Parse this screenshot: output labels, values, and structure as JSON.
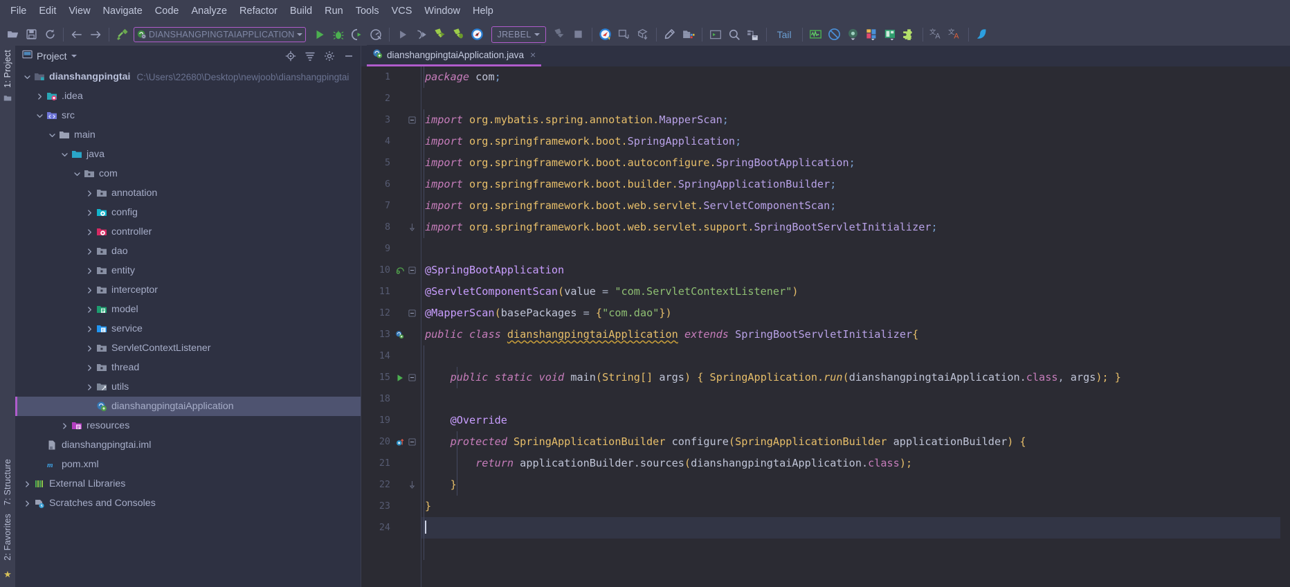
{
  "window": {
    "theme_bg": "#2e3142",
    "editor_bg": "#2b2b33",
    "accent": "#b05ccc"
  },
  "menubar": {
    "items": [
      {
        "label": "File"
      },
      {
        "label": "Edit"
      },
      {
        "label": "View"
      },
      {
        "label": "Navigate"
      },
      {
        "label": "Code"
      },
      {
        "label": "Analyze"
      },
      {
        "label": "Refactor"
      },
      {
        "label": "Build"
      },
      {
        "label": "Run"
      },
      {
        "label": "Tools"
      },
      {
        "label": "VCS"
      },
      {
        "label": "Window"
      },
      {
        "label": "Help"
      }
    ]
  },
  "toolbar": {
    "open_tip": "Open",
    "save_tip": "Save All",
    "sync_tip": "Synchronize",
    "back_tip": "Back",
    "forward_tip": "Forward",
    "build_tip": "Build Project",
    "run_config_label": "DIANSHANGPINGTAIAPPLICATION",
    "run_tip": "Run",
    "debug_tip": "Debug",
    "run_coverage_tip": "Run with Coverage",
    "profile_tip": "Profile",
    "rerun_tip": "Rerun",
    "attach_tip": "Attach",
    "jrebel_run_tip": "Run with JRebel",
    "jrebel_debug_tip": "Debug with JRebel",
    "jrebel_console_tip": "JRebel Console",
    "jrebel_label": "JREBEL",
    "stop_grey_tip": "Stop",
    "stop_tip": "Stop",
    "update_tip": "Update Project",
    "commit_tip": "Commit",
    "push_tip": "Push",
    "settings_tip": "Settings",
    "project_structure_tip": "Project Structure",
    "terminal_tip": "Terminal",
    "search_tip": "Search Everywhere",
    "database_tip": "Database",
    "tail_label": "Tail",
    "monitor_tip": "Monitor",
    "noaccess_tip": "No Access",
    "record_tip": "Record",
    "layout_tip": "Layout",
    "preview_tip": "Preview",
    "plugin_tip": "Plugin",
    "translate_tip": "Translate",
    "translate2_tip": "Translate Reverse",
    "cloud_tip": "Cloud"
  },
  "leftstrip": {
    "project_label": "1: Project",
    "structure_label": "7: Structure",
    "favorites_label": "2: Favorites"
  },
  "project_panel": {
    "title": "Project",
    "title_caret": "▾",
    "icons": [
      {
        "name": "locate-icon"
      },
      {
        "name": "collapse-all-icon"
      },
      {
        "name": "settings-icon"
      },
      {
        "name": "hide-icon"
      }
    ],
    "tree": [
      {
        "depth": 0,
        "arrow": "down",
        "icon": "module-folder",
        "label": "dianshangpingtai",
        "bold": true,
        "path": "C:\\Users\\22680\\Desktop\\newjoob\\dianshangpingtai"
      },
      {
        "depth": 1,
        "arrow": "right",
        "icon": "idea-folder",
        "label": ".idea"
      },
      {
        "depth": 1,
        "arrow": "down",
        "icon": "src-folder",
        "label": "src"
      },
      {
        "depth": 2,
        "arrow": "down",
        "icon": "plain-folder",
        "label": "main"
      },
      {
        "depth": 3,
        "arrow": "down",
        "icon": "java-folder",
        "label": "java"
      },
      {
        "depth": 4,
        "arrow": "down",
        "icon": "pkg-folder",
        "label": "com"
      },
      {
        "depth": 5,
        "arrow": "right",
        "icon": "pkg-folder",
        "label": "annotation"
      },
      {
        "depth": 5,
        "arrow": "right",
        "icon": "config-folder",
        "label": "config"
      },
      {
        "depth": 5,
        "arrow": "right",
        "icon": "controller-folder",
        "label": "controller"
      },
      {
        "depth": 5,
        "arrow": "right",
        "icon": "pkg-folder",
        "label": "dao"
      },
      {
        "depth": 5,
        "arrow": "right",
        "icon": "pkg-folder",
        "label": "entity"
      },
      {
        "depth": 5,
        "arrow": "right",
        "icon": "pkg-folder",
        "label": "interceptor"
      },
      {
        "depth": 5,
        "arrow": "right",
        "icon": "model-folder",
        "label": "model"
      },
      {
        "depth": 5,
        "arrow": "right",
        "icon": "service-folder",
        "label": "service"
      },
      {
        "depth": 5,
        "arrow": "right",
        "icon": "pkg-folder",
        "label": "ServletContextListener"
      },
      {
        "depth": 5,
        "arrow": "right",
        "icon": "pkg-folder",
        "label": "thread"
      },
      {
        "depth": 5,
        "arrow": "right",
        "icon": "utils-folder",
        "label": "utils"
      },
      {
        "depth": 5,
        "arrow": "none",
        "icon": "spring-class",
        "label": "dianshangpingtaiApplication",
        "selected": true
      },
      {
        "depth": 3,
        "arrow": "right",
        "icon": "resources-folder",
        "label": "resources"
      },
      {
        "depth": 1,
        "arrow": "none",
        "icon": "iml-file",
        "label": "dianshangpingtai.iml"
      },
      {
        "depth": 1,
        "arrow": "none",
        "icon": "maven-file",
        "label": "pom.xml"
      },
      {
        "depth": 0,
        "arrow": "right",
        "icon": "libraries",
        "label": "External Libraries"
      },
      {
        "depth": 0,
        "arrow": "right",
        "icon": "scratches",
        "label": "Scratches and Consoles"
      }
    ]
  },
  "editor": {
    "tab": {
      "label": "dianshangpingtaiApplication.java",
      "close": "×",
      "icon": "spring-class-icon"
    },
    "lines": [
      {
        "num": "1",
        "gutter": "",
        "fold": "none",
        "indent": 0,
        "tokens": [
          {
            "t": "package ",
            "c": "kwp"
          },
          {
            "t": "com",
            "c": "id"
          },
          {
            "t": ";",
            "c": "semi"
          }
        ]
      },
      {
        "num": "2",
        "gutter": "",
        "fold": "none",
        "indent": 0,
        "tokens": []
      },
      {
        "num": "3",
        "gutter": "",
        "fold": "start",
        "indent": 0,
        "tokens": [
          {
            "t": "import ",
            "c": "kwp"
          },
          {
            "t": "org.mybatis.spring.annotation.",
            "c": "pkg"
          },
          {
            "t": "MapperScan",
            "c": "cls"
          },
          {
            "t": ";",
            "c": "semi"
          }
        ]
      },
      {
        "num": "4",
        "gutter": "",
        "fold": "none",
        "indent": 0,
        "tokens": [
          {
            "t": "import ",
            "c": "kwp"
          },
          {
            "t": "org.springframework.boot.",
            "c": "pkg"
          },
          {
            "t": "SpringApplication",
            "c": "cls"
          },
          {
            "t": ";",
            "c": "semi"
          }
        ]
      },
      {
        "num": "5",
        "gutter": "",
        "fold": "none",
        "indent": 0,
        "tokens": [
          {
            "t": "import ",
            "c": "kwp"
          },
          {
            "t": "org.springframework.boot.autoconfigure.",
            "c": "pkg"
          },
          {
            "t": "SpringBootApplication",
            "c": "cls"
          },
          {
            "t": ";",
            "c": "semi"
          }
        ]
      },
      {
        "num": "6",
        "gutter": "",
        "fold": "none",
        "indent": 0,
        "tokens": [
          {
            "t": "import ",
            "c": "kwp"
          },
          {
            "t": "org.springframework.boot.builder.",
            "c": "pkg"
          },
          {
            "t": "SpringApplicationBuilder",
            "c": "cls"
          },
          {
            "t": ";",
            "c": "semi"
          }
        ]
      },
      {
        "num": "7",
        "gutter": "",
        "fold": "none",
        "indent": 0,
        "tokens": [
          {
            "t": "import ",
            "c": "kwp"
          },
          {
            "t": "org.springframework.boot.web.servlet.",
            "c": "pkg"
          },
          {
            "t": "ServletComponentScan",
            "c": "cls"
          },
          {
            "t": ";",
            "c": "semi"
          }
        ]
      },
      {
        "num": "8",
        "gutter": "",
        "fold": "end",
        "indent": 0,
        "tokens": [
          {
            "t": "import ",
            "c": "kwp"
          },
          {
            "t": "org.springframework.boot.web.servlet.support.",
            "c": "pkg"
          },
          {
            "t": "SpringBootServletInitializer",
            "c": "cls"
          },
          {
            "t": ";",
            "c": "semi"
          }
        ]
      },
      {
        "num": "9",
        "gutter": "",
        "fold": "none",
        "indent": 0,
        "tokens": []
      },
      {
        "num": "10",
        "gutter": "bean",
        "fold": "start",
        "indent": 0,
        "tokens": [
          {
            "t": "@SpringBootApplication",
            "c": "ann"
          }
        ]
      },
      {
        "num": "11",
        "gutter": "",
        "fold": "none",
        "indent": 0,
        "tokens": [
          {
            "t": "@ServletComponentScan",
            "c": "ann"
          },
          {
            "t": "(",
            "c": "paren"
          },
          {
            "t": "value",
            "c": "id"
          },
          {
            "t": " = ",
            "c": "punc"
          },
          {
            "t": "\"com.ServletContextListener\"",
            "c": "str"
          },
          {
            "t": ")",
            "c": "paren"
          }
        ]
      },
      {
        "num": "12",
        "gutter": "",
        "fold": "mid",
        "indent": 0,
        "tokens": [
          {
            "t": "@MapperScan",
            "c": "ann"
          },
          {
            "t": "(",
            "c": "paren"
          },
          {
            "t": "basePackages",
            "c": "id"
          },
          {
            "t": " = ",
            "c": "punc"
          },
          {
            "t": "{",
            "c": "brace"
          },
          {
            "t": "\"com.dao\"",
            "c": "str"
          },
          {
            "t": "}",
            "c": "brace"
          },
          {
            "t": ")",
            "c": "paren"
          }
        ]
      },
      {
        "num": "13",
        "gutter": "bean-run",
        "fold": "none",
        "indent": 0,
        "tokens": [
          {
            "t": "public ",
            "c": "kwp"
          },
          {
            "t": "class ",
            "c": "kwp"
          },
          {
            "t": "dianshangpingtaiApplication",
            "c": "ident-u wavy"
          },
          {
            "t": " ",
            "c": "punc"
          },
          {
            "t": "extends ",
            "c": "kwp"
          },
          {
            "t": "SpringBootServletInitializer",
            "c": "cls"
          },
          {
            "t": "{",
            "c": "brace"
          }
        ]
      },
      {
        "num": "14",
        "gutter": "",
        "fold": "none",
        "indent": 0,
        "tokens": []
      },
      {
        "num": "15",
        "gutter": "run",
        "fold": "start",
        "indent": 1,
        "tokens": [
          {
            "t": "    ",
            "c": "punc"
          },
          {
            "t": "public ",
            "c": "kwp"
          },
          {
            "t": "static ",
            "c": "kwp"
          },
          {
            "t": "void ",
            "c": "kwp"
          },
          {
            "t": "main",
            "c": "id"
          },
          {
            "t": "(",
            "c": "paren"
          },
          {
            "t": "String",
            "c": "typ"
          },
          {
            "t": "[] ",
            "c": "paren"
          },
          {
            "t": "args",
            "c": "id"
          },
          {
            "t": ") ",
            "c": "paren"
          },
          {
            "t": "{ ",
            "c": "brace"
          },
          {
            "t": "SpringApplication.",
            "c": "typ"
          },
          {
            "t": "run",
            "c": "fn"
          },
          {
            "t": "(",
            "c": "paren"
          },
          {
            "t": "dianshangpingtaiApplication.",
            "c": "id"
          },
          {
            "t": "class",
            "c": "kwpn"
          },
          {
            "t": ", ",
            "c": "punc"
          },
          {
            "t": "args",
            "c": "id"
          },
          {
            "t": "); ",
            "c": "paren"
          },
          {
            "t": "}",
            "c": "brace"
          }
        ]
      },
      {
        "num": "18",
        "gutter": "",
        "fold": "none",
        "indent": 1,
        "tokens": []
      },
      {
        "num": "19",
        "gutter": "",
        "fold": "none",
        "indent": 1,
        "tokens": [
          {
            "t": "    ",
            "c": "punc"
          },
          {
            "t": "@Override",
            "c": "ann"
          }
        ]
      },
      {
        "num": "20",
        "gutter": "override",
        "fold": "start",
        "indent": 1,
        "tokens": [
          {
            "t": "    ",
            "c": "punc"
          },
          {
            "t": "protected ",
            "c": "kwp"
          },
          {
            "t": "SpringApplicationBuilder ",
            "c": "typ"
          },
          {
            "t": "configure",
            "c": "id"
          },
          {
            "t": "(",
            "c": "paren"
          },
          {
            "t": "SpringApplicationBuilder ",
            "c": "typ"
          },
          {
            "t": "applicationBuilder",
            "c": "id"
          },
          {
            "t": ") ",
            "c": "paren"
          },
          {
            "t": "{",
            "c": "brace"
          }
        ]
      },
      {
        "num": "21",
        "gutter": "",
        "fold": "none",
        "indent": 2,
        "tokens": [
          {
            "t": "        ",
            "c": "punc"
          },
          {
            "t": "return ",
            "c": "kwp"
          },
          {
            "t": "applicationBuilder.",
            "c": "id"
          },
          {
            "t": "sources",
            "c": "id"
          },
          {
            "t": "(",
            "c": "paren"
          },
          {
            "t": "dianshangpingtaiApplication.",
            "c": "id"
          },
          {
            "t": "class",
            "c": "kwpn"
          },
          {
            "t": ");",
            "c": "paren"
          }
        ]
      },
      {
        "num": "22",
        "gutter": "",
        "fold": "end",
        "indent": 1,
        "tokens": [
          {
            "t": "    ",
            "c": "punc"
          },
          {
            "t": "}",
            "c": "brace"
          }
        ]
      },
      {
        "num": "23",
        "gutter": "",
        "fold": "none",
        "indent": 0,
        "tokens": [
          {
            "t": "}",
            "c": "brace"
          }
        ]
      },
      {
        "num": "24",
        "gutter": "",
        "fold": "none",
        "indent": 0,
        "current": true,
        "caret": true,
        "tokens": []
      }
    ]
  }
}
